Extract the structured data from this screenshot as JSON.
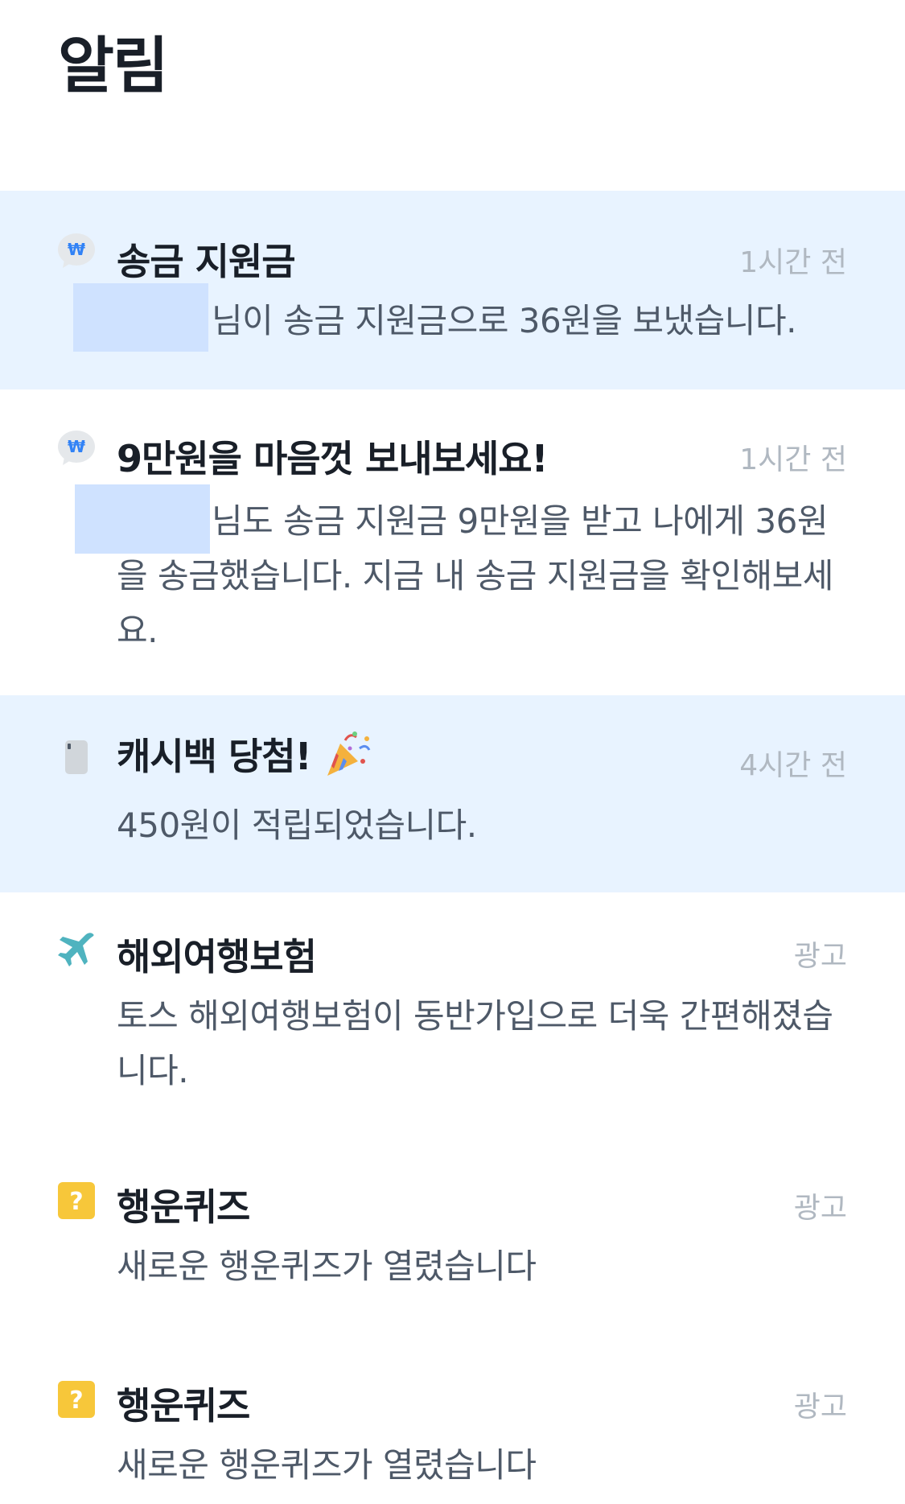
{
  "header": {
    "title": "알림"
  },
  "notifications": [
    {
      "icon": "won-chat-bubble-icon",
      "title": "송금 지원금",
      "time": "1시간 전",
      "body": "님이 송금 지원금으로 36원을 보냈습니다.",
      "unread": true
    },
    {
      "icon": "won-chat-bubble-icon",
      "title": "9만원을 마음껏 보내보세요!",
      "time": "1시간 전",
      "body": "님도 송금 지원금 9만원을 받고 나에게 36원을 송금했습니다. 지금 내 송금 지원금을 확인해보세요.",
      "unread": false
    },
    {
      "icon": "card-icon",
      "title": "캐시백 당첨!",
      "title_emoji": "party-popper-icon",
      "time": "4시간 전",
      "body": "450원이 적립되었습니다.",
      "unread": true
    },
    {
      "icon": "airplane-icon",
      "title": "해외여행보험",
      "time": "광고",
      "body": "토스 해외여행보험이 동반가입으로 더욱 간편해졌습니다.",
      "unread": false
    },
    {
      "icon": "question-mark-icon",
      "title": "행운퀴즈",
      "time": "광고",
      "body": "새로운 행운퀴즈가 열렸습니다",
      "unread": false
    },
    {
      "icon": "question-mark-icon",
      "title": "행운퀴즈",
      "time": "광고",
      "body": "새로운 행운퀴즈가 열렸습니다",
      "unread": false
    }
  ],
  "colors": {
    "unread_bg": "#e8f3ff",
    "title": "#191f28",
    "body": "#4e5968",
    "time": "#b0b8c1",
    "won_icon": "#3182f6",
    "airplane_icon": "#4fb3bf",
    "quiz_icon": "#f7c73a",
    "redaction": "#cfe2ff"
  }
}
